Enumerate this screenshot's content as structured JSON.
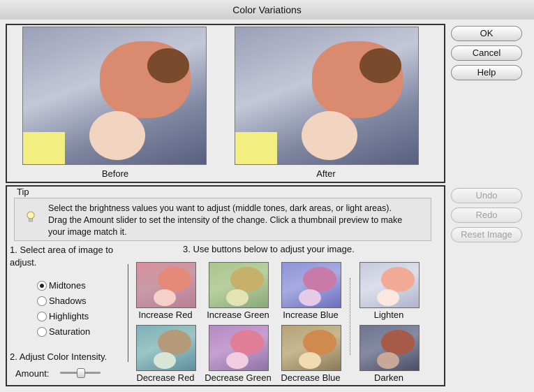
{
  "window": {
    "title": "Color Variations"
  },
  "preview": {
    "before_label": "Before",
    "after_label": "After"
  },
  "buttons": {
    "ok": "OK",
    "cancel": "Cancel",
    "help": "Help",
    "undo": "Undo",
    "redo": "Redo",
    "reset": "Reset Image"
  },
  "tip": {
    "heading": "Tip",
    "text": "Select the brightness values you want to adjust (middle tones, dark areas, or light areas). Drag the Amount slider to set the intensity of the change. Click a thumbnail preview to make your image match it."
  },
  "area": {
    "step1": "1. Select area of image to adjust.",
    "options": [
      "Midtones",
      "Shadows",
      "Highlights",
      "Saturation"
    ],
    "selected": "Midtones"
  },
  "intensity": {
    "step2": "2. Adjust Color Intensity.",
    "amount_label": "Amount:",
    "amount_value": 0.5
  },
  "adjust": {
    "step3": "3. Use buttons below to adjust your image.",
    "increase": [
      "Increase Red",
      "Increase Green",
      "Increase Blue"
    ],
    "decrease": [
      "Decrease Red",
      "Decrease Green",
      "Decrease Blue"
    ],
    "lighten": "Lighten",
    "darken": "Darken"
  }
}
